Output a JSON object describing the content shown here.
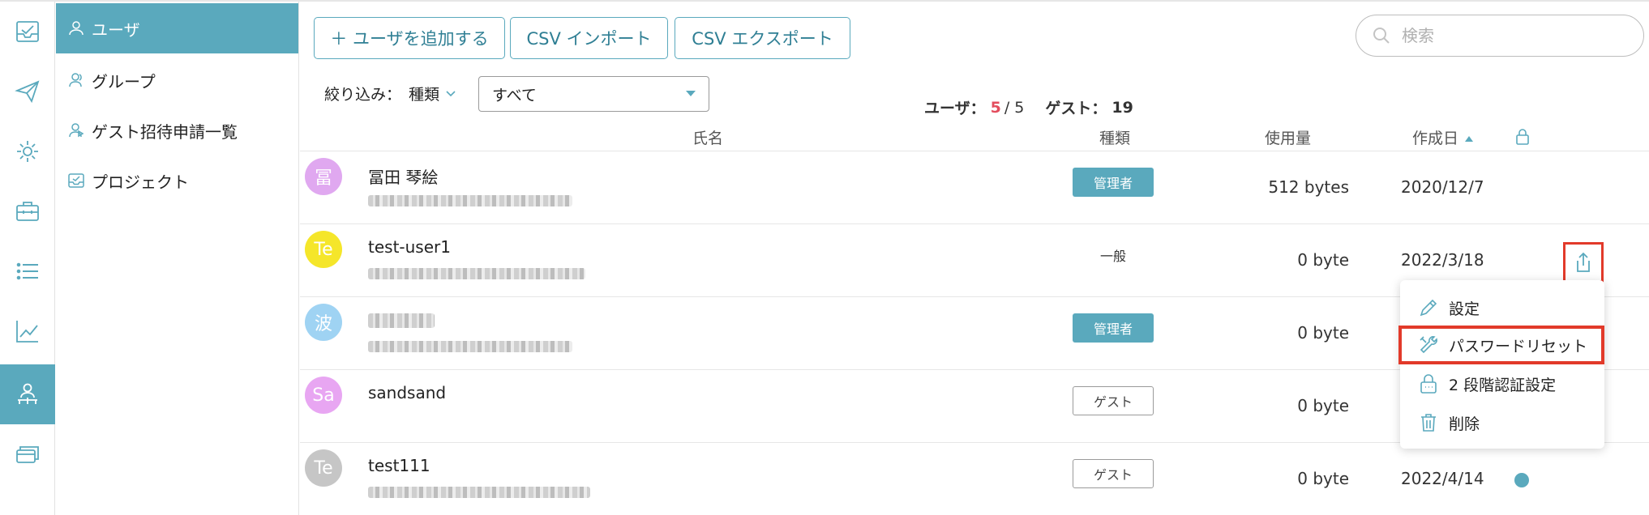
{
  "sidebar": {
    "items": [
      {
        "label": "ユーザ",
        "active": true
      },
      {
        "label": "グループ"
      },
      {
        "label": "ゲスト招待申請一覧"
      },
      {
        "label": "プロジェクト"
      }
    ]
  },
  "toolbar": {
    "add_user": "＋ ユーザを追加する",
    "csv_import": "CSV インポート",
    "csv_export": "CSV エクスポート",
    "search_placeholder": "検索"
  },
  "filter": {
    "label": "絞り込み：",
    "type_label": "種類",
    "selected": "すべて"
  },
  "counts": {
    "user_label": "ユーザ：",
    "user_current": "5",
    "user_sep": " / 5",
    "guest_label": "ゲスト：",
    "guest_count": "19"
  },
  "table": {
    "headers": {
      "name": "氏名",
      "type": "種類",
      "usage": "使用量",
      "created": "作成日"
    },
    "rows": [
      {
        "avatar": "冨",
        "avatar_color": "#e0a8f0",
        "name": "冨田 琴絵",
        "role": "管理者",
        "role_kind": "admin",
        "usage": "512 bytes",
        "created": "2020/12/7"
      },
      {
        "avatar": "Te",
        "avatar_color": "#f5e62a",
        "name": "test-user1",
        "role": "一般",
        "role_kind": "normal",
        "usage": "0 byte",
        "created": "2022/3/18"
      },
      {
        "avatar": "波",
        "avatar_color": "#9fd3f3",
        "name": "",
        "role": "管理者",
        "role_kind": "admin",
        "usage": "0 byte",
        "created": ""
      },
      {
        "avatar": "Sa",
        "avatar_color": "#e8a6f2",
        "name": "sandsand",
        "role": "ゲスト",
        "role_kind": "guest",
        "usage": "0 byte",
        "created": ""
      },
      {
        "avatar": "Te",
        "avatar_color": "#c6c6c6",
        "name": "test111",
        "role": "ゲスト",
        "role_kind": "guest",
        "usage": "0 byte",
        "created": "2022/4/14"
      }
    ]
  },
  "menu": {
    "items": [
      {
        "label": "設定",
        "icon": "pencil-icon"
      },
      {
        "label": "パスワードリセット",
        "icon": "wrench-icon"
      },
      {
        "label": "2 段階認証設定",
        "icon": "lock-icon"
      },
      {
        "label": "削除",
        "icon": "trash-icon"
      }
    ]
  },
  "colors": {
    "accent": "#5aa9bd",
    "highlight": "#e23a2a",
    "count_red": "#e34d5d"
  }
}
